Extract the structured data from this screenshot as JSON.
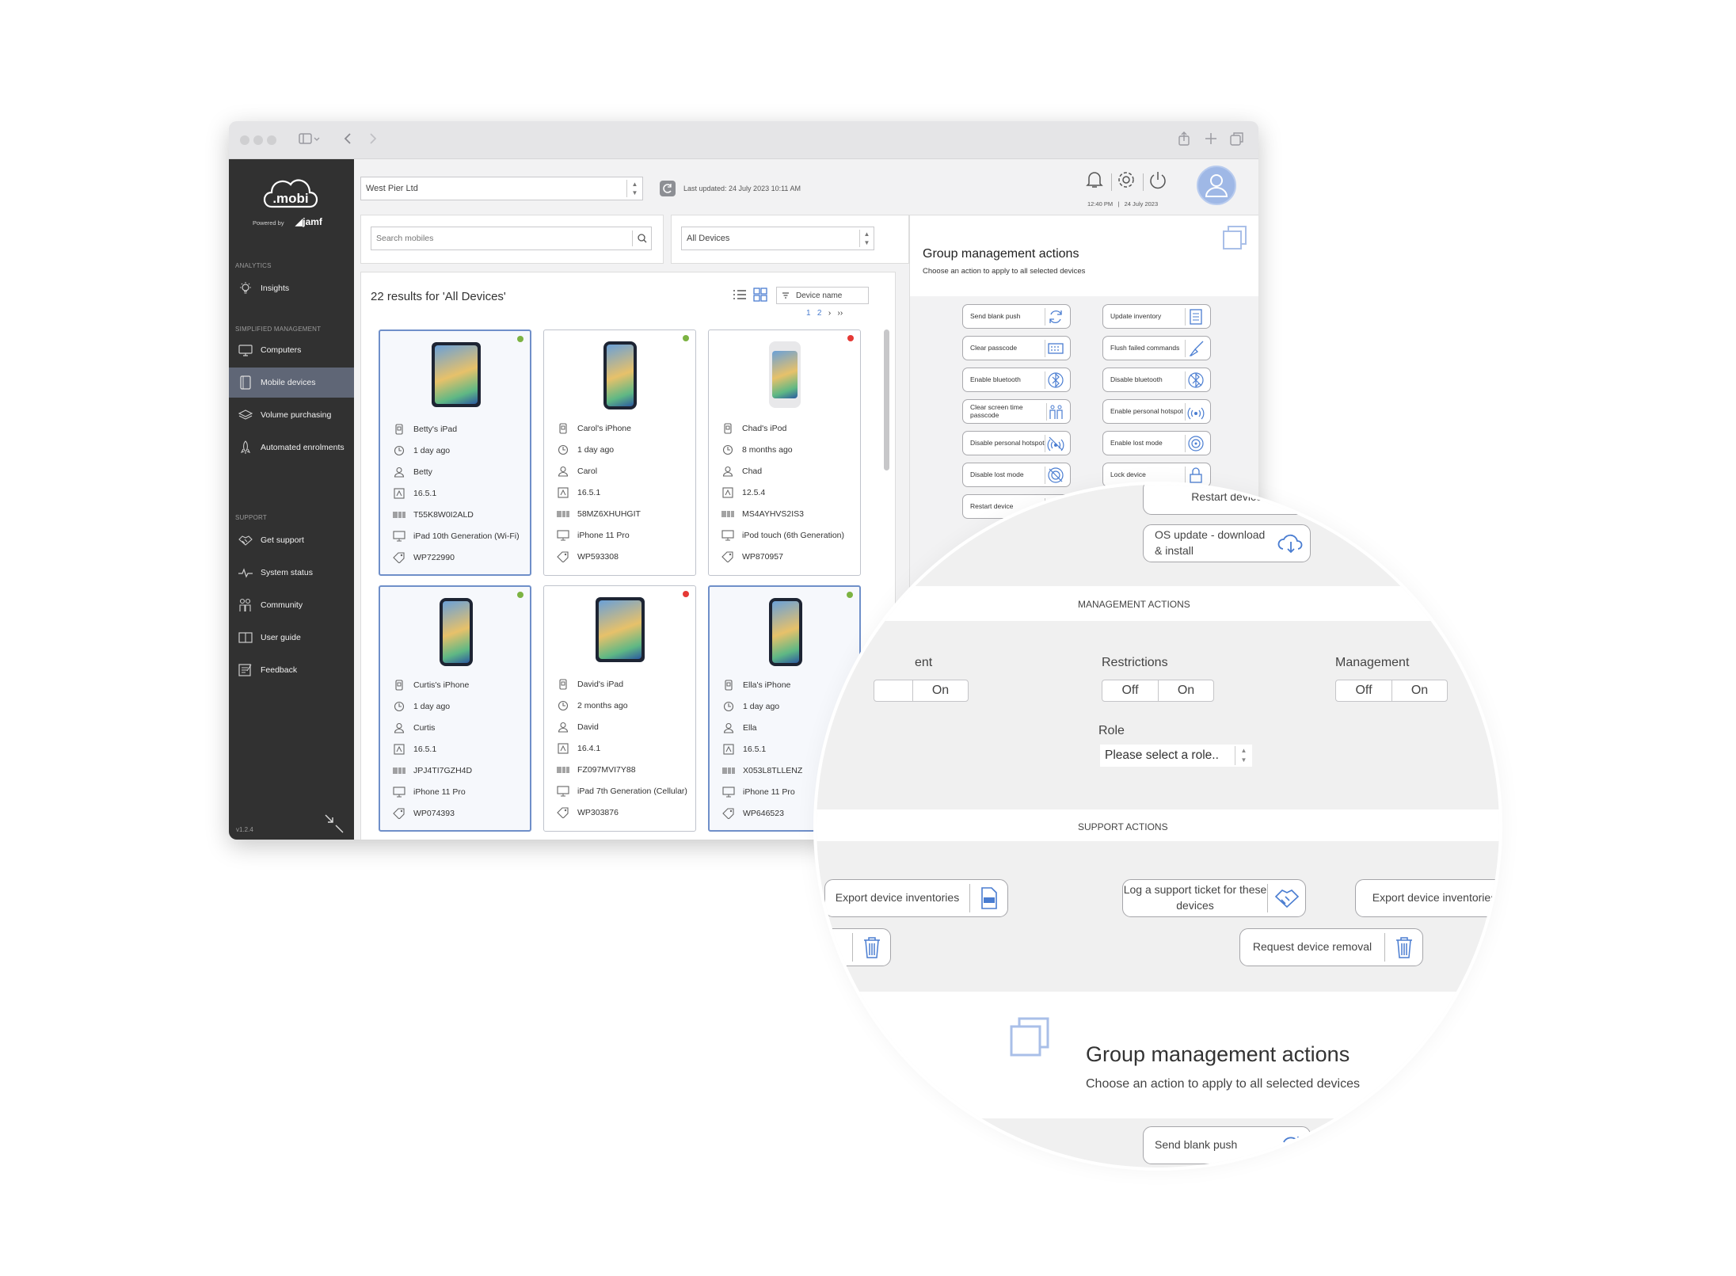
{
  "window": {
    "title": ""
  },
  "brand": {
    "logo": ".mobi",
    "powered_by": "Powered by",
    "partner": "jamf",
    "version": "v1.2.4"
  },
  "sidebar": {
    "sections": {
      "analytics": "ANALYTICS",
      "simplified": "SIMPLIFIED MANAGEMENT",
      "support": "SUPPORT"
    },
    "items": [
      {
        "label": "Insights",
        "icon": "lightbulb-icon"
      },
      {
        "label": "Computers",
        "icon": "monitor-icon"
      },
      {
        "label": "Mobile devices",
        "icon": "tablet-icon",
        "active": true
      },
      {
        "label": "Volume purchasing",
        "icon": "layers-icon"
      },
      {
        "label": "Automated enrolments",
        "icon": "rocket-icon"
      },
      {
        "label": "Get support",
        "icon": "handshake-icon"
      },
      {
        "label": "System status",
        "icon": "pulse-icon"
      },
      {
        "label": "Community",
        "icon": "people-icon"
      },
      {
        "label": "User guide",
        "icon": "book-icon"
      },
      {
        "label": "Feedback",
        "icon": "feedback-icon"
      }
    ]
  },
  "header": {
    "organisation": "West Pier Ltd",
    "last_updated": "Last updated: 24 July 2023 10:11 AM",
    "time": "12:40 PM",
    "separator": "|",
    "date": "24 July 2023"
  },
  "search": {
    "placeholder": "Search mobiles",
    "filter": "All Devices"
  },
  "results": {
    "summary": "22 results for 'All Devices'",
    "sort": "Device name",
    "pages": [
      "1",
      "2"
    ]
  },
  "devices": [
    {
      "name": "Betty's iPad",
      "seen": "1 day ago",
      "user": "Betty",
      "os": "16.5.1",
      "serial": "T55K8W0I2ALD",
      "model": "iPad 10th Generation (Wi-Fi)",
      "asset": "WP722990",
      "status": "green",
      "selected": true
    },
    {
      "name": "Carol's iPhone",
      "seen": "1 day ago",
      "user": "Carol",
      "os": "16.5.1",
      "serial": "58MZ6XHUHGIT",
      "model": "iPhone 11 Pro",
      "asset": "WP593308",
      "status": "green",
      "selected": false
    },
    {
      "name": "Chad's iPod",
      "seen": "8 months ago",
      "user": "Chad",
      "os": "12.5.4",
      "serial": "MS4AYHVS2IS3",
      "model": "iPod touch (6th Generation)",
      "asset": "WP870957",
      "status": "red",
      "selected": false
    },
    {
      "name": "Curtis's iPhone",
      "seen": "1 day ago",
      "user": "Curtis",
      "os": "16.5.1",
      "serial": "JPJ4TI7GZH4D",
      "model": "iPhone 11 Pro",
      "asset": "WP074393",
      "status": "green",
      "selected": true
    },
    {
      "name": "David's iPad",
      "seen": "2 months ago",
      "user": "David",
      "os": "16.4.1",
      "serial": "FZ097MVI7Y88",
      "model": "iPad 7th Generation (Cellular)",
      "asset": "WP303876",
      "status": "red",
      "selected": false
    },
    {
      "name": "Ella's iPhone",
      "seen": "1 day ago",
      "user": "Ella",
      "os": "16.5.1",
      "serial": "X053L8TLLENZ",
      "model": "iPhone 11 Pro",
      "asset": "WP646523",
      "status": "green",
      "selected": true
    }
  ],
  "group_panel": {
    "title": "Group management actions",
    "subtitle": "Choose an action to apply to all selected devices",
    "actions": [
      {
        "label": "Send blank push",
        "icon": "refresh-icon"
      },
      {
        "label": "Update inventory",
        "icon": "list-icon"
      },
      {
        "label": "Clear passcode",
        "icon": "keypad-icon"
      },
      {
        "label": "Flush failed commands",
        "icon": "broom-icon"
      },
      {
        "label": "Enable bluetooth",
        "icon": "bluetooth-icon"
      },
      {
        "label": "Disable bluetooth",
        "icon": "bluetooth-off-icon"
      },
      {
        "label": "Clear screen time passcode",
        "icon": "family-icon"
      },
      {
        "label": "Enable personal hotspot",
        "icon": "hotspot-icon"
      },
      {
        "label": "Disable personal hotspot",
        "icon": "hotspot-off-icon"
      },
      {
        "label": "Enable lost mode",
        "icon": "target-icon"
      },
      {
        "label": "Disable lost mode",
        "icon": "target-off-icon"
      },
      {
        "label": "Lock device",
        "icon": "lock-icon"
      },
      {
        "label": "Restart device",
        "icon": "power-icon"
      },
      {
        "label": "OS update - download & install",
        "icon": "cloud-download-icon"
      }
    ],
    "ma_cut": "MA"
  },
  "zoom": {
    "restart_label": "Restart device",
    "os_update": "OS update - download & install",
    "management_heading": "MANAGEMENT ACTIONS",
    "partial_label": "ent",
    "restrictions": "Restrictions",
    "management": "Management",
    "off": "Off",
    "on": "On",
    "role_label": "Role",
    "role_placeholder": "Please select a role..",
    "support_heading": "SUPPORT ACTIONS",
    "export1": "Export device inventories",
    "support_ticket": "Log a support ticket for these devices",
    "export2": "Export device inventories",
    "removal": "Request device removal",
    "title": "Group management actions",
    "subtitle": "Choose an action to apply to all selected devices",
    "send_blank_push": "Send blank push"
  },
  "colors": {
    "sidebar": "#313131",
    "active_nav": "#5f6676",
    "accent": "#4a7dd1",
    "status_green": "#7cb342",
    "status_red": "#e53935",
    "avatar": "#9fb8e6"
  }
}
